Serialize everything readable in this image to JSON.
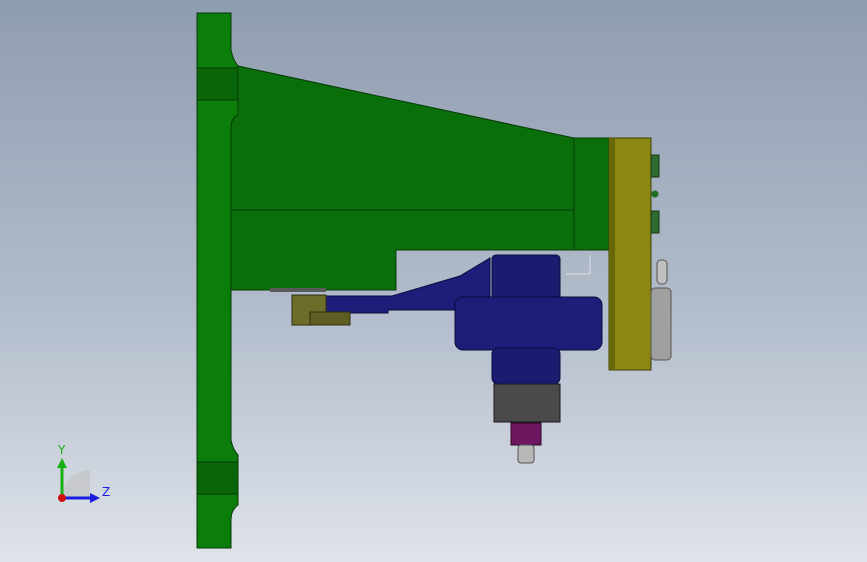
{
  "viewport": {
    "background_top": "#8f9db0",
    "background_bottom": "#dfe3ea"
  },
  "model": {
    "parts": [
      {
        "name": "mounting-plate",
        "color": "#0a7d0a"
      },
      {
        "name": "tapered-housing",
        "color": "#0a6e0a"
      },
      {
        "name": "yellow-bracket",
        "color": "#8a8712"
      },
      {
        "name": "blue-lever",
        "color": "#1e1e7a"
      },
      {
        "name": "gray-block",
        "color": "#4a4a4a"
      },
      {
        "name": "purple-nut",
        "color": "#6e1660"
      },
      {
        "name": "olive-clamp",
        "color": "#6d6d2a"
      },
      {
        "name": "silver-wheel",
        "color": "#9a9a9a"
      }
    ]
  },
  "triad": {
    "y_label": "Y",
    "z_label": "Z",
    "y_color": "#16b016",
    "z_color": "#1d1de0",
    "x_color": "#d01010"
  }
}
